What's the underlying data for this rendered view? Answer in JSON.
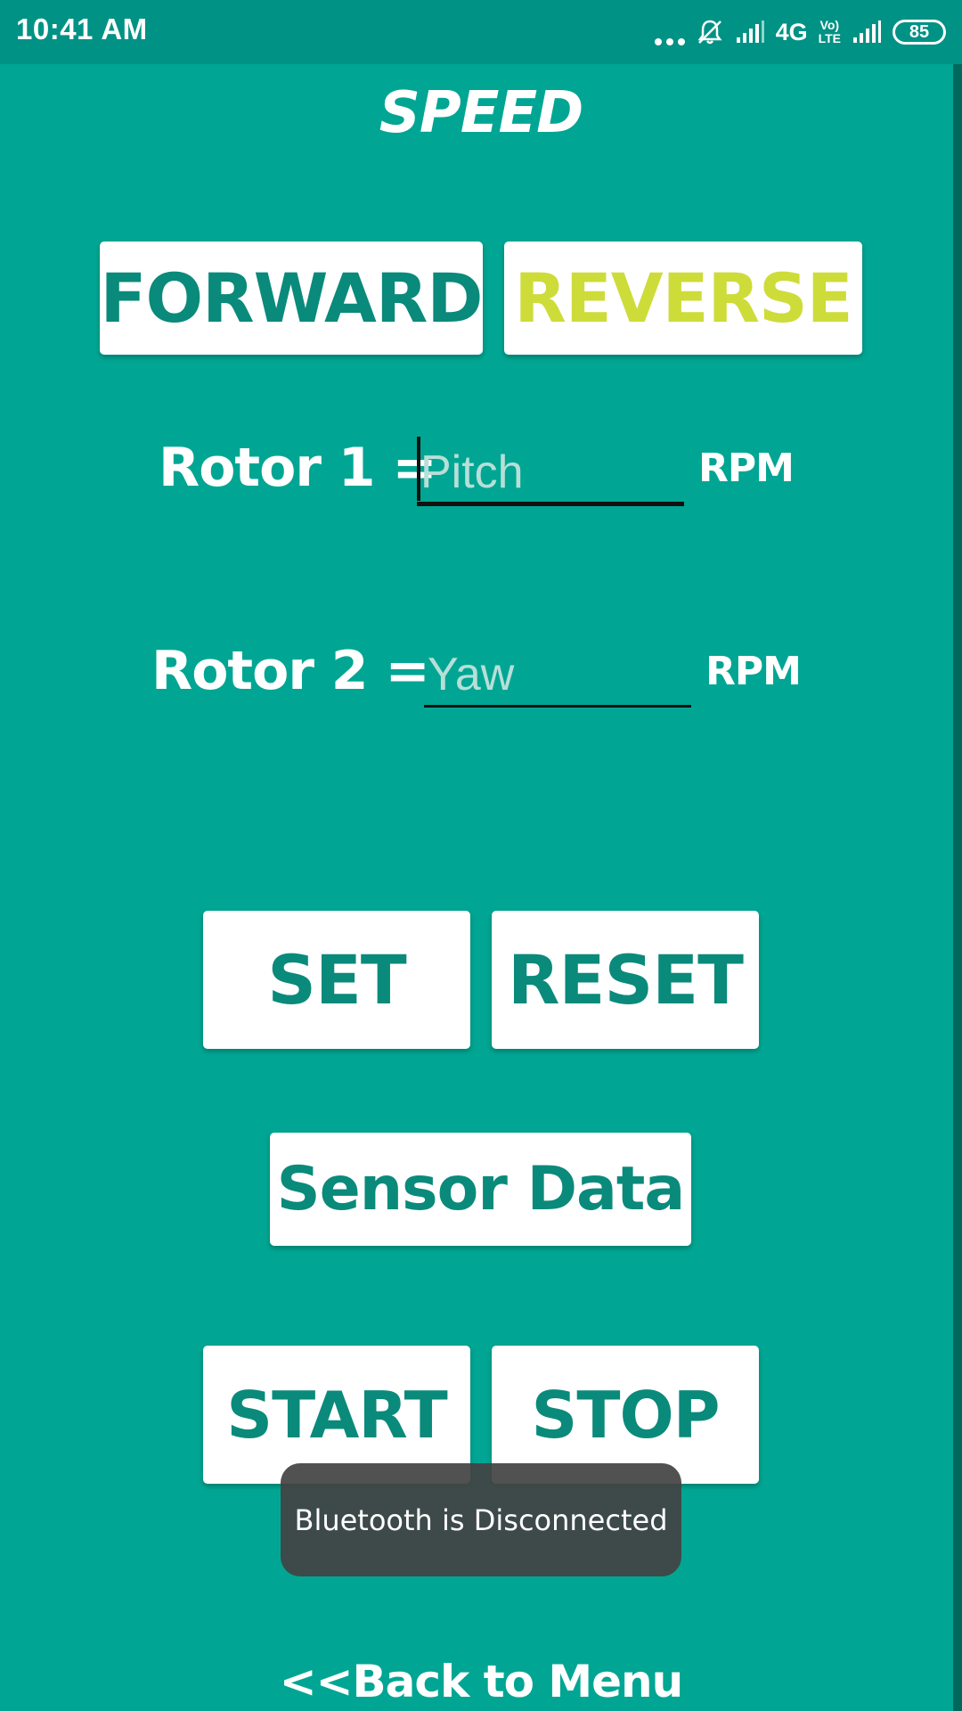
{
  "status_bar": {
    "time": "10:41 AM",
    "network": "4G",
    "volte": [
      "Vo)",
      "LTE"
    ],
    "battery": "85",
    "icons": [
      "more-dots-icon",
      "silent-bell-icon",
      "signal-icon",
      "signal-icon-2"
    ]
  },
  "title": "SPEED",
  "direction": {
    "forward_label": "FORWARD",
    "reverse_label": "REVERSE",
    "reverse_color": "#cddc39"
  },
  "rotor1": {
    "label": "Rotor 1 =",
    "value": "",
    "placeholder": "Pitch",
    "unit": "RPM"
  },
  "rotor2": {
    "label": "Rotor 2 =",
    "value": "",
    "placeholder": "Yaw",
    "unit": "RPM"
  },
  "controls": {
    "set_label": "SET",
    "reset_label": "RESET",
    "sensor_label": "Sensor Data",
    "start_label": "START",
    "stop_label": "STOP"
  },
  "toast": "Bluetooth is Disconnected",
  "back_link": "<<Back to Menu",
  "colors": {
    "background": "#00a693",
    "status_bar": "#009285",
    "button_text": "#0a8a7b",
    "button_bg": "#ffffff"
  }
}
